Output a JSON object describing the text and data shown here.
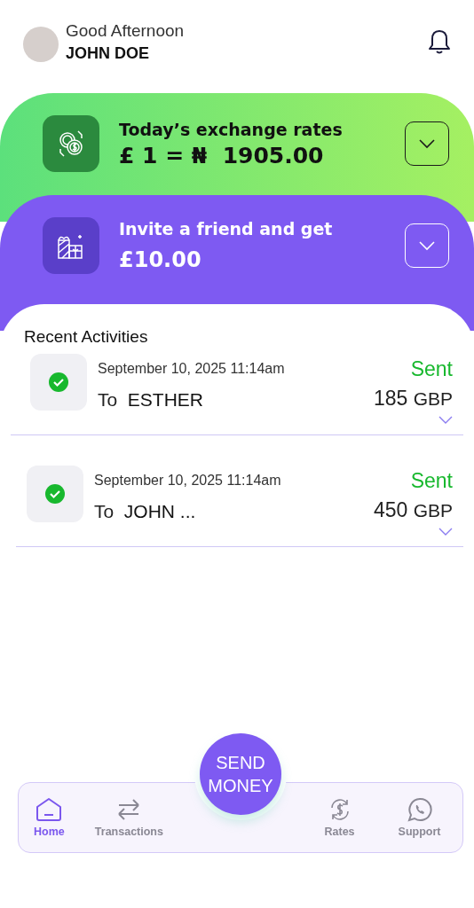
{
  "header": {
    "greeting": "Good Afternoon",
    "user_name": "JOHN DOE"
  },
  "cards": [
    {
      "kind": "rates",
      "title": "Today’s exchange rates",
      "value": "£ 1 = ₦  1905.00"
    },
    {
      "kind": "invite",
      "title": "Invite a friend and get",
      "value": "£10.00"
    }
  ],
  "recent": {
    "title": "Recent Activities",
    "items": [
      {
        "date": "September 10, 2025 11:14am",
        "prefix": "To",
        "recipient": "ESTHER",
        "status": "Sent",
        "amount": "185",
        "currency": "GBP"
      },
      {
        "date": "September 10, 2025 11:14am",
        "prefix": "To",
        "recipient": "JOHN ...",
        "status": "Sent",
        "amount": "450",
        "currency": "GBP"
      }
    ]
  },
  "send_button": "SEND MONEY",
  "nav": [
    {
      "kind": "home",
      "label": "Home",
      "selected": true
    },
    {
      "kind": "transactions",
      "label": "Transactions",
      "selected": false
    },
    {
      "kind": "rates",
      "label": "Rates",
      "selected": false
    },
    {
      "kind": "support",
      "label": "Support",
      "selected": false
    }
  ]
}
